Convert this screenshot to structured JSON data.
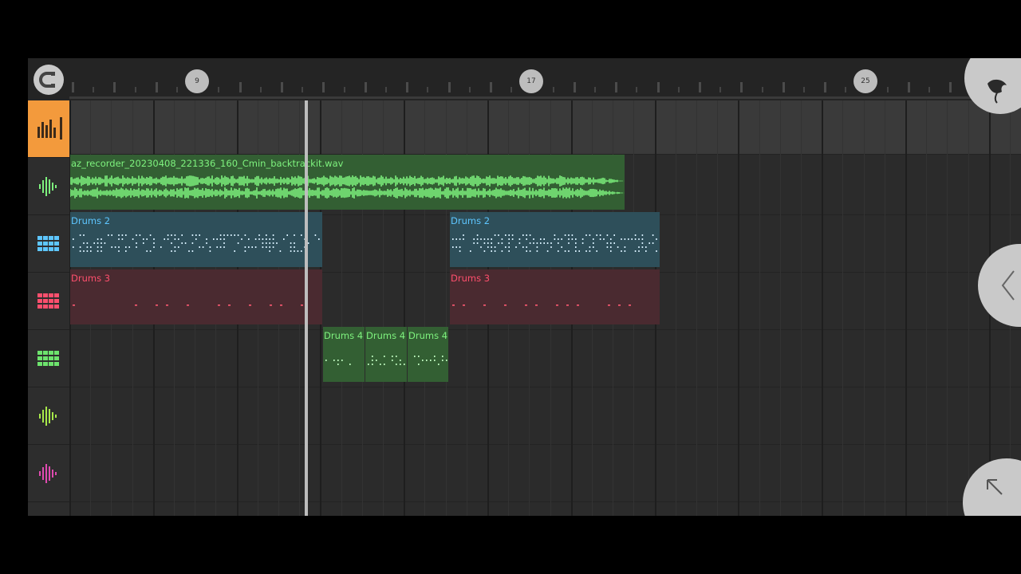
{
  "ruler": {
    "markers": [
      "9",
      "17",
      "25"
    ]
  },
  "tracks": [
    {
      "icon": "mixer-icon",
      "color": "#f39a3c"
    },
    {
      "icon": "waveform-icon",
      "color": "#7ef27e"
    },
    {
      "icon": "step-sequencer-icon",
      "color": "#5ec6ff"
    },
    {
      "icon": "step-sequencer-icon",
      "color": "#ff4f6d"
    },
    {
      "icon": "step-sequencer-icon",
      "color": "#6de36d"
    },
    {
      "icon": "waveform-icon",
      "color": "#a7e84a"
    },
    {
      "icon": "waveform-icon",
      "color": "#e04ab0"
    }
  ],
  "clips": {
    "audio": {
      "name": "az_recorder_20230408_221336_160_Cmin_backtrackit.wav",
      "color": "#7ef27e"
    },
    "drums2": {
      "name": "Drums 2",
      "color": "#5ec6ff"
    },
    "drums3": {
      "name": "Drums 3",
      "color": "#ff4f6d"
    },
    "drums4": {
      "name": "Drums 4",
      "color": "#7ef27e"
    }
  }
}
